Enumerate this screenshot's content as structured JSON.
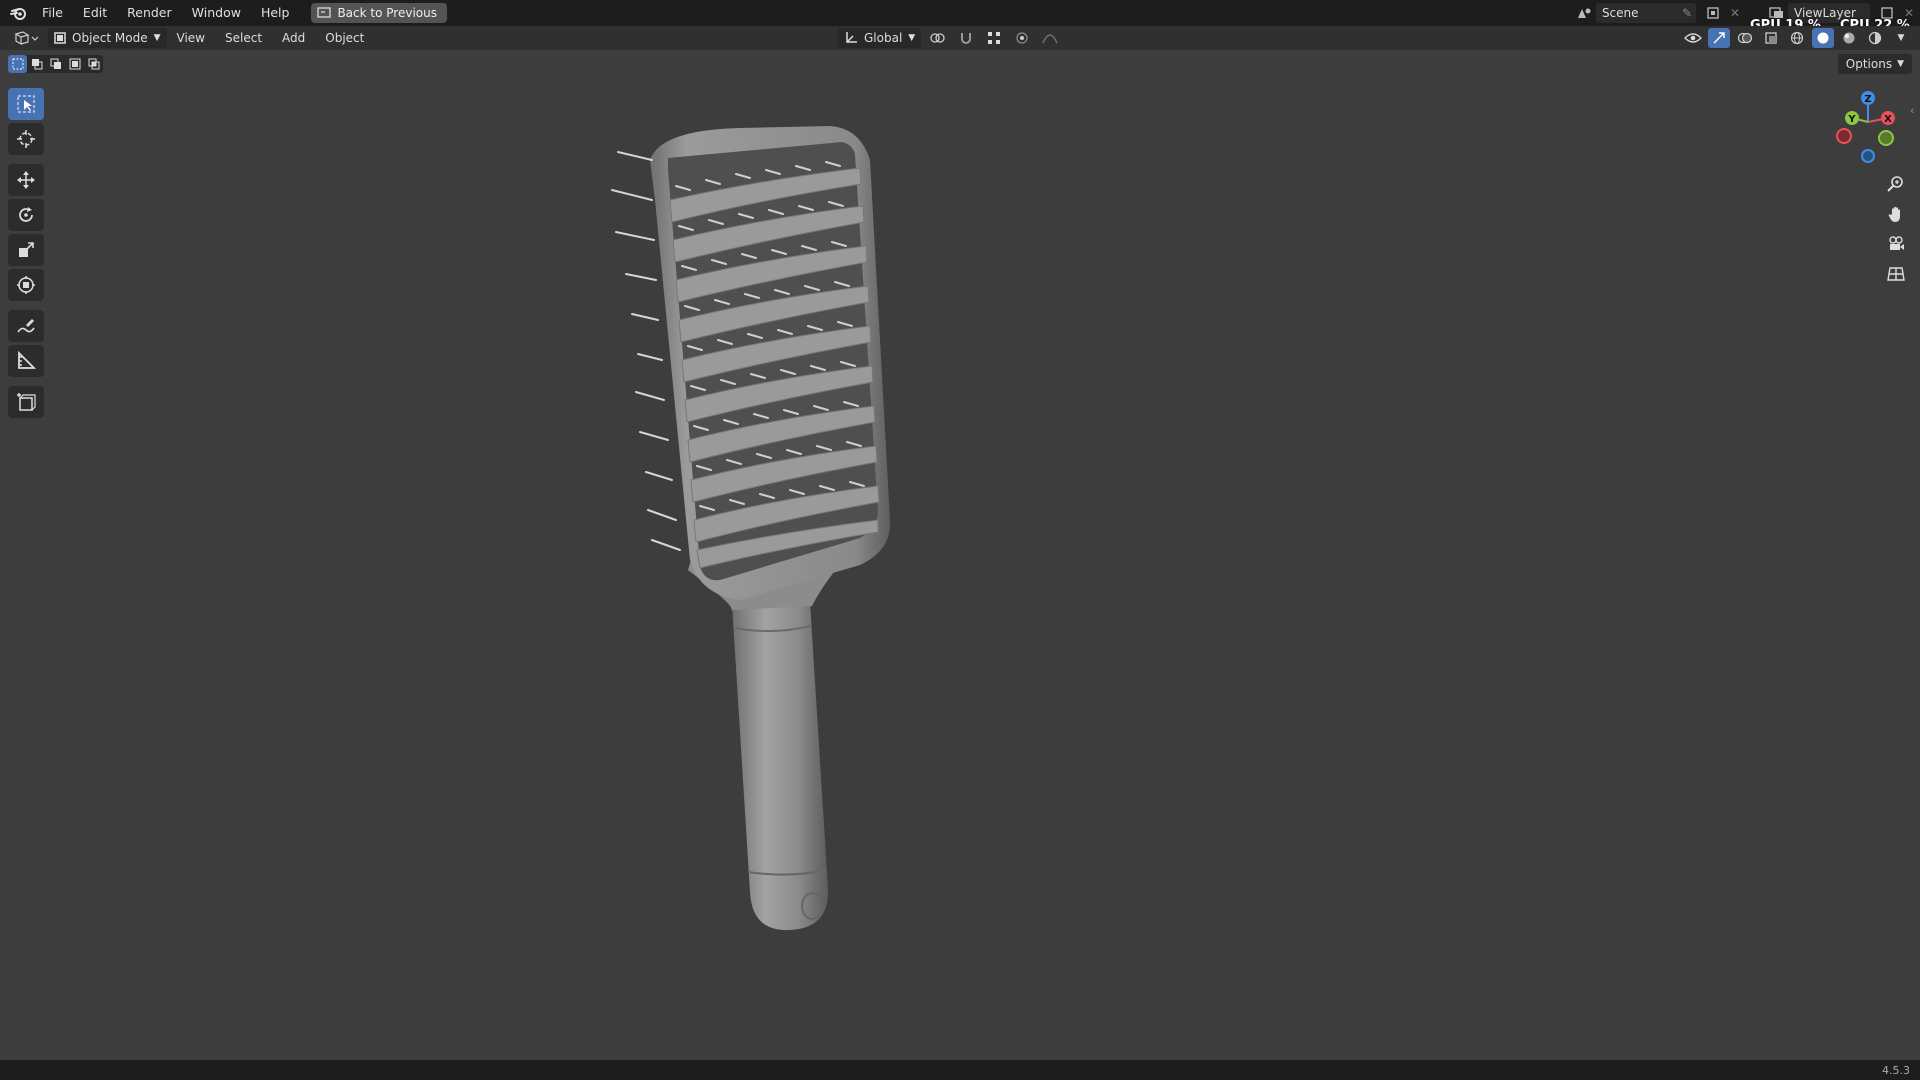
{
  "topbar": {
    "menus": [
      "File",
      "Edit",
      "Render",
      "Window",
      "Help"
    ],
    "back_button": "Back to Previous",
    "scene_name": "Scene",
    "view_layer": "ViewLayer",
    "gpu_label": "GPU",
    "gpu_value": "19 %",
    "cpu_label": "CPU",
    "cpu_value": "22 %"
  },
  "header": {
    "mode": "Object Mode",
    "menus": [
      "View",
      "Select",
      "Add",
      "Object"
    ],
    "transform_orientation": "Global",
    "options_label": "Options"
  },
  "toolbar": {
    "tools": [
      "select-box",
      "cursor",
      "move",
      "rotate",
      "scale",
      "transform",
      "annotate",
      "measure",
      "add-cube"
    ],
    "active": "select-box"
  },
  "gizmo": {
    "axes": [
      "X",
      "Y",
      "Z"
    ]
  },
  "status": {
    "version": "4.5.3"
  },
  "colors": {
    "accent": "#4772b3",
    "background": "#3d3d3d",
    "axis_x": "#e8515a",
    "axis_y": "#8cc63f",
    "axis_z": "#3f8ee8"
  }
}
